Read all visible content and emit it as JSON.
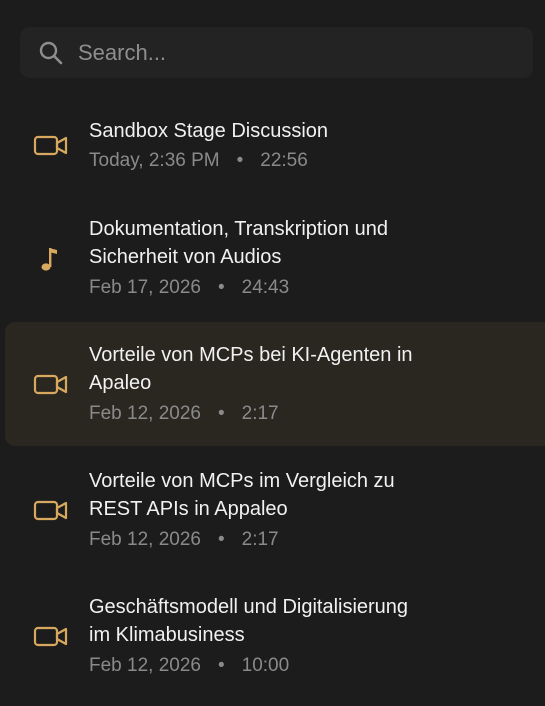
{
  "search": {
    "placeholder": "Search...",
    "value": ""
  },
  "colors": {
    "accent": "#d9a85f",
    "background": "#1c1c1c",
    "selected_background": "#2a2721"
  },
  "items": [
    {
      "icon": "video-icon",
      "title_lines": [
        "Sandbox Stage Discussion"
      ],
      "date": "Today, 2:36 PM",
      "separator": "•",
      "duration": "22:56",
      "selected": false
    },
    {
      "icon": "music-note-icon",
      "title_lines": [
        "Dokumentation, Transkription und",
        "Sicherheit von Audios"
      ],
      "date": "Feb 17, 2026",
      "separator": "•",
      "duration": "24:43",
      "selected": false
    },
    {
      "icon": "video-icon",
      "title_lines": [
        "Vorteile von MCPs bei KI-Agenten in",
        "Apaleo"
      ],
      "date": "Feb 12, 2026",
      "separator": "•",
      "duration": "2:17",
      "selected": true
    },
    {
      "icon": "video-icon",
      "title_lines": [
        "Vorteile von MCPs im Vergleich zu",
        "REST APIs in Appaleo"
      ],
      "date": "Feb 12, 2026",
      "separator": "•",
      "duration": "2:17",
      "selected": false
    },
    {
      "icon": "video-icon",
      "title_lines": [
        "Geschäftsmodell und Digitalisierung",
        "im Klimabusiness"
      ],
      "date": "Feb 12, 2026",
      "separator": "•",
      "duration": "10:00",
      "selected": false
    }
  ]
}
